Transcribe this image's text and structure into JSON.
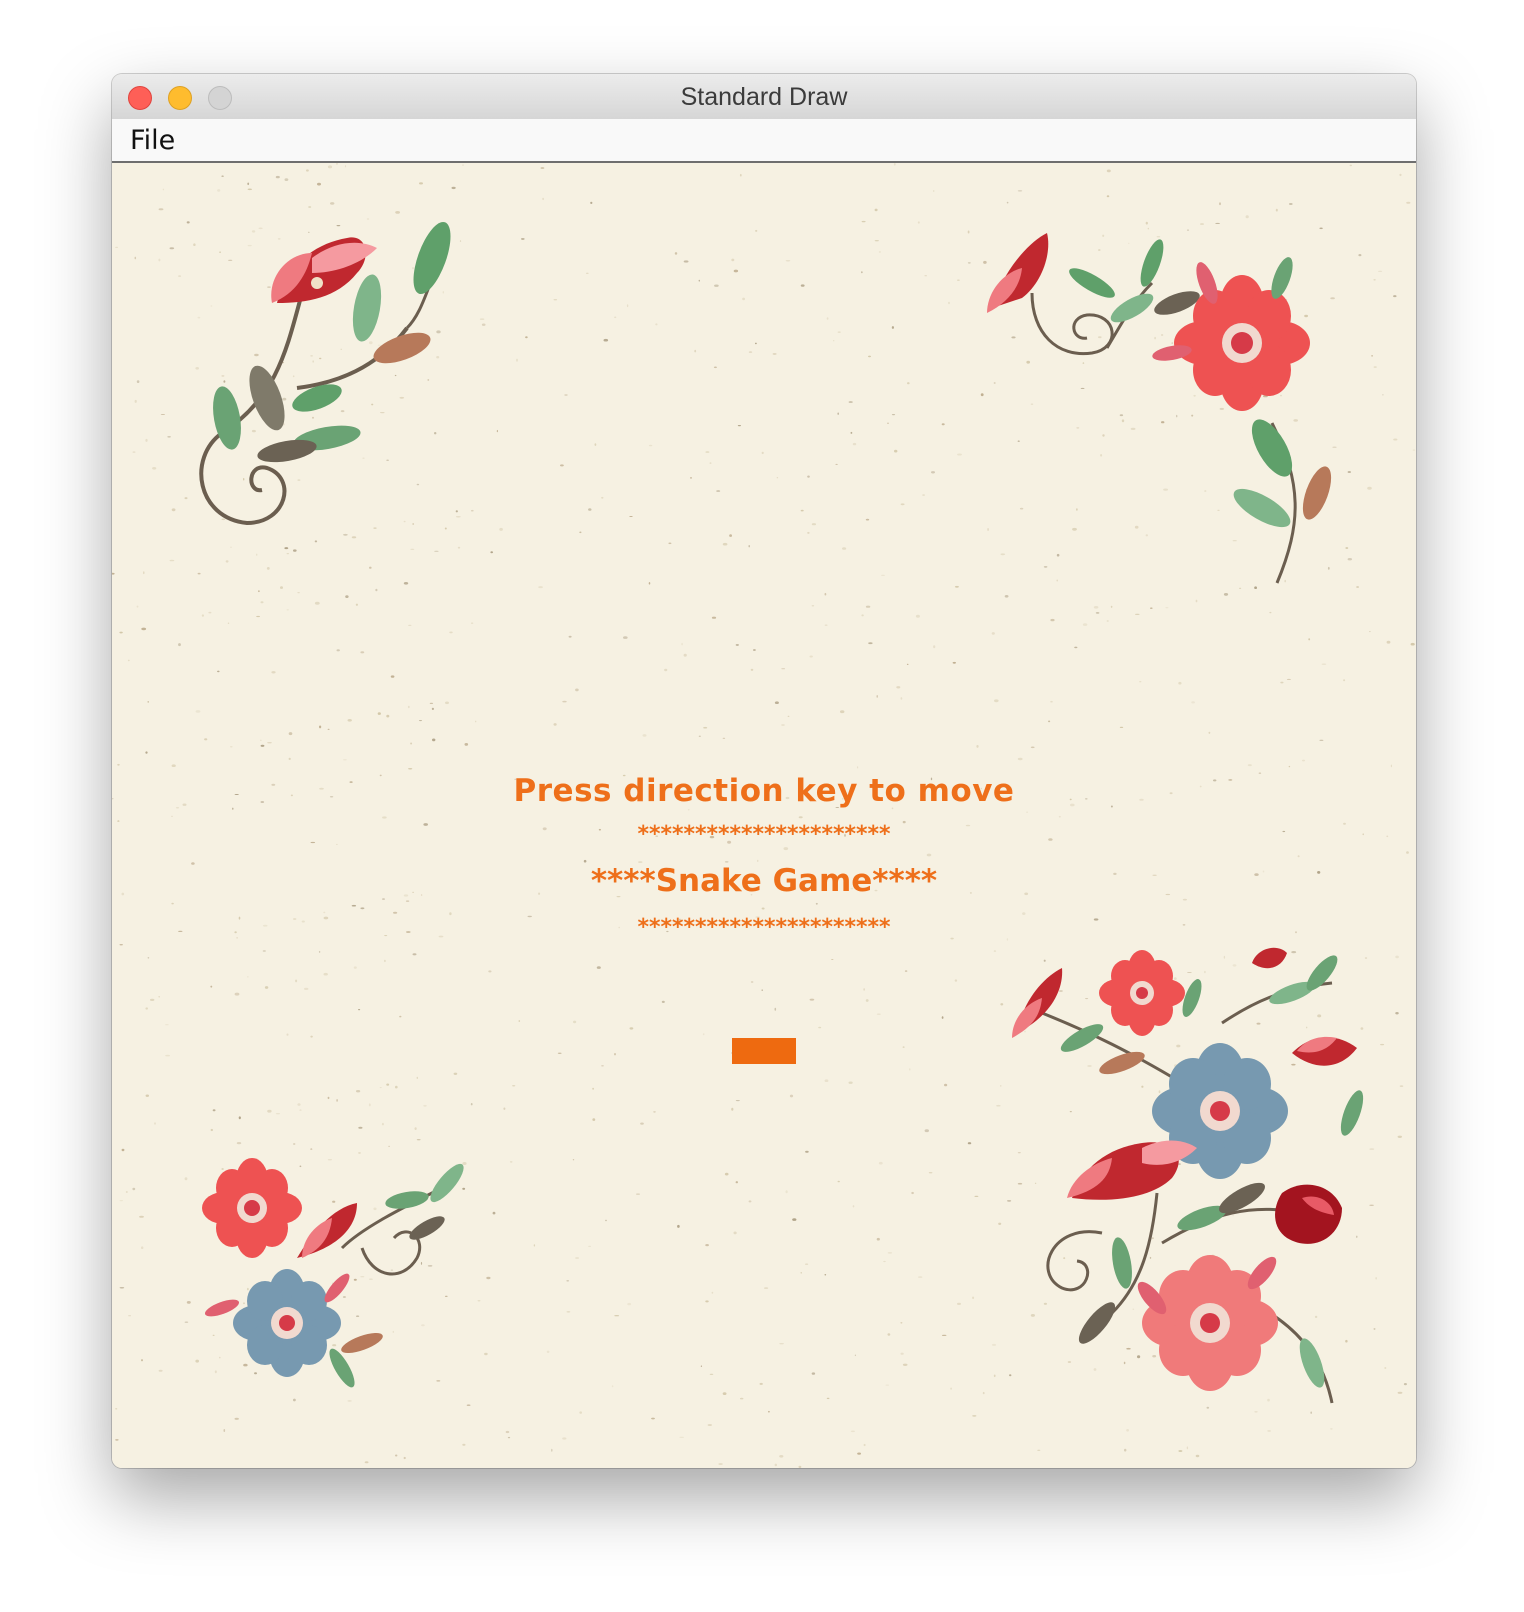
{
  "window": {
    "title": "Standard Draw"
  },
  "menu": {
    "file": "File"
  },
  "game": {
    "instruction": "Press direction key to move",
    "stars_top": "**********************",
    "title": "****Snake Game****",
    "stars_bottom": "**********************"
  },
  "colors": {
    "text": "#ee6f1a",
    "snake": "#ee6a10",
    "background": "#f6f1e2"
  },
  "icons": {
    "close": "close-icon",
    "minimize": "minimize-icon",
    "zoom": "zoom-icon"
  }
}
